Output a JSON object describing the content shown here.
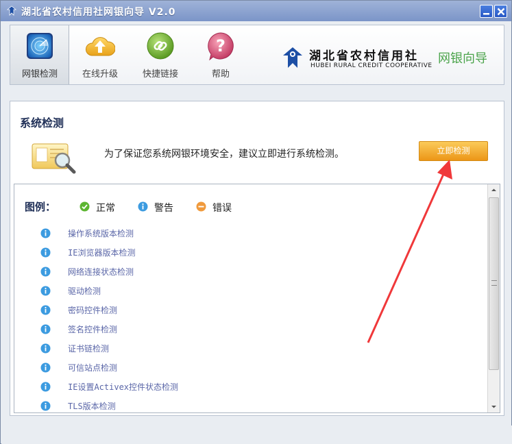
{
  "window": {
    "title": "湖北省农村信用社网银向导 V2.0"
  },
  "toolbar": {
    "tools": [
      {
        "label": "网银检测",
        "icon": "radar-icon"
      },
      {
        "label": "在线升级",
        "icon": "cloud-upload-icon"
      },
      {
        "label": "快捷链接",
        "icon": "chain-link-icon"
      },
      {
        "label": "帮助",
        "icon": "help-question-icon"
      }
    ]
  },
  "logo": {
    "name_cn": "湖北省农村信用社",
    "name_en": "HUBEI RURAL CREDIT  COOPERATIVE",
    "side_text": "网银向导"
  },
  "panel": {
    "title": "系统检测",
    "intro": "为了保证您系统网银环境安全，建议立即进行系统检测。",
    "check_button": "立即检测"
  },
  "legend": {
    "title": "图例：",
    "items": [
      {
        "label": "正常",
        "color": "#5cb531"
      },
      {
        "label": "警告",
        "color": "#3c9be0"
      },
      {
        "label": "错误",
        "color": "#f09a3c"
      }
    ]
  },
  "checks": [
    "操作系统版本检测",
    "IE浏览器版本检测",
    "网络连接状态检测",
    "驱动检测",
    "密码控件检测",
    "签名控件检测",
    "证书链检测",
    "可信站点检测",
    "IE设置Activex控件状态检测",
    "TLS版本检测"
  ],
  "colors": {
    "info_icon": "#3c9be0",
    "accent_button": "#ec9617",
    "arrow": "#f0383a"
  }
}
